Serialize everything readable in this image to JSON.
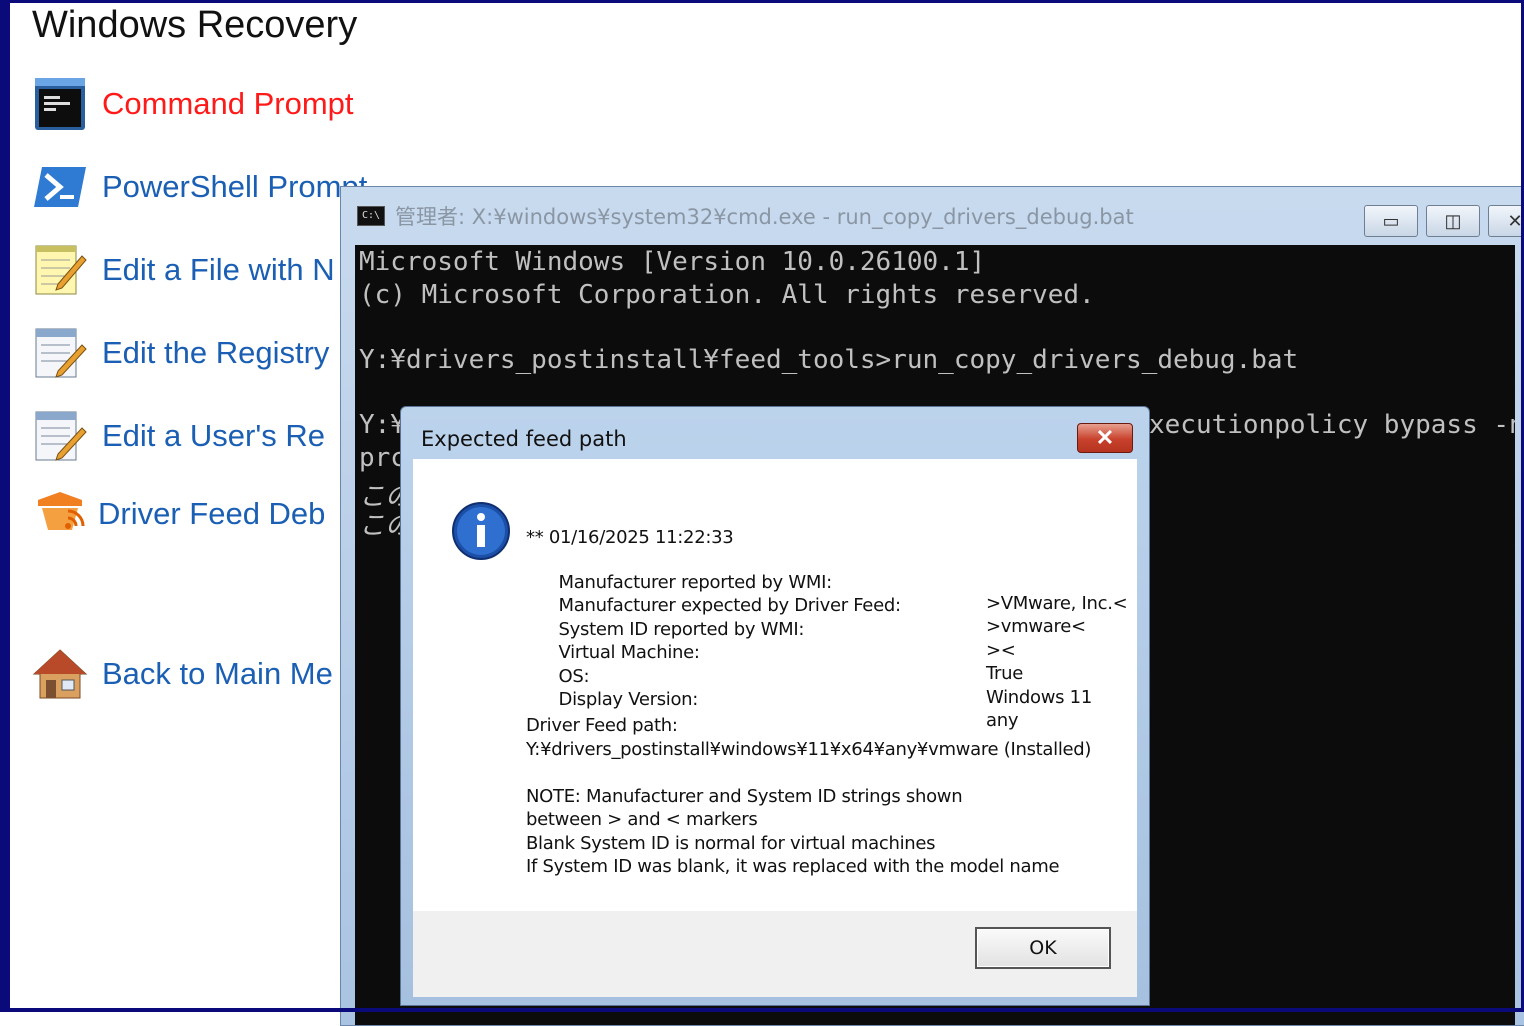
{
  "recovery": {
    "title": "Windows Recovery",
    "items": [
      {
        "label": "Command Prompt",
        "icon": "command-prompt-icon",
        "active": true
      },
      {
        "label": "PowerShell Prompt",
        "icon": "powershell-icon"
      },
      {
        "label": "Edit a File with N",
        "icon": "notepad-edit-icon"
      },
      {
        "label": "Edit the Registry",
        "icon": "registry-edit-icon"
      },
      {
        "label": "Edit a User's Re",
        "icon": "user-registry-edit-icon"
      },
      {
        "label": "Driver Feed Deb",
        "icon": "driver-feed-icon"
      },
      {
        "label": "Back to Main Me",
        "icon": "home-icon"
      }
    ],
    "accent_color": "#1a5fb4",
    "active_color": "#ff1a1a"
  },
  "cmd": {
    "title": "管理者: X:¥windows¥system32¥cmd.exe - run_copy_drivers_debug.bat",
    "icon_text": "C:\\",
    "lines": [
      "Microsoft Windows [Version 10.0.26100.1]",
      "(c) Microsoft Corporation. All rights reserved.",
      "Y:¥drivers_postinstall¥feed_tools>run_copy_drivers_debug.bat",
      "Y:¥",
      "xecutionpolicy bypass -no",
      "prc",
      "この",
      "この"
    ],
    "minimize": "▭",
    "maximize": "◫",
    "close": "✕"
  },
  "dialog": {
    "title": "Expected feed path",
    "close": "✕",
    "timestamp": "** 01/16/2025 11:22:33",
    "rows": [
      {
        "label": "Manufacturer reported by WMI:",
        "value": ">VMware, Inc.<"
      },
      {
        "label": "Manufacturer expected by Driver Feed:",
        "value": ">vmware<"
      },
      {
        "label": "System ID reported by WMI:",
        "value": "><"
      },
      {
        "label": "Virtual Machine:",
        "value": "True"
      },
      {
        "label": "OS:",
        "value": "Windows 11"
      },
      {
        "label": "Display Version:",
        "value": "any"
      }
    ],
    "feed_path_label": "Driver Feed path:",
    "feed_path": "Y:¥drivers_postinstall¥windows¥11¥x64¥any¥vmware (Installed)",
    "notes": [
      "NOTE: Manufacturer and System ID strings shown",
      "between > and < markers",
      "Blank System ID is normal for virtual machines",
      "If System ID was blank, it was replaced with the model name"
    ],
    "ok": "OK"
  }
}
